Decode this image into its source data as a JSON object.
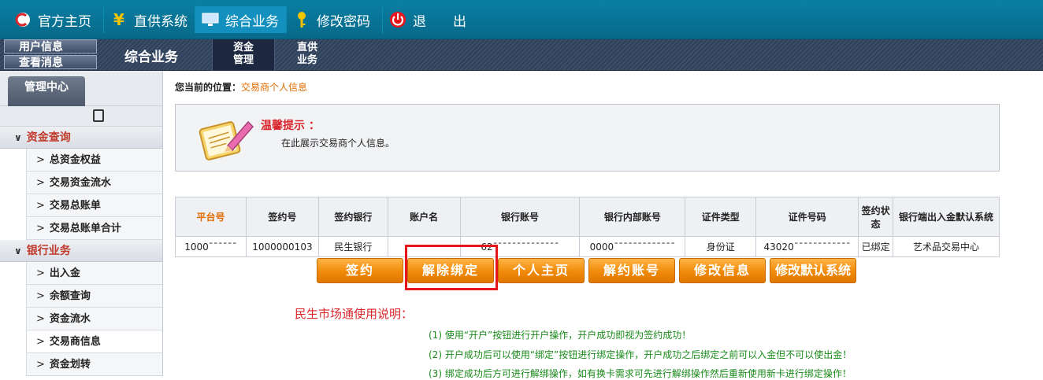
{
  "topnav": {
    "items": [
      {
        "label": "官方主页",
        "icon": "home-logo-icon"
      },
      {
        "label": "直供系统",
        "icon": "yen-icon"
      },
      {
        "label": "综合业务",
        "icon": "monitor-icon"
      },
      {
        "label": "修改密码",
        "icon": "key-icon"
      },
      {
        "label": "退　　出",
        "icon": "power-icon"
      }
    ]
  },
  "subbar": {
    "user_info": "用户信息",
    "view_msg": "查看消息",
    "title": "综合业务",
    "tabs": [
      {
        "line1": "资金",
        "line2": "管理"
      },
      {
        "line1": "直供",
        "line2": "业务"
      }
    ]
  },
  "sidebar": {
    "mgmt_tab": "管理中心",
    "groups": [
      {
        "title": "资金查询",
        "items": [
          "总资金权益",
          "交易资金流水",
          "交易总账单",
          "交易总账单合计"
        ]
      },
      {
        "title": "银行业务",
        "items": [
          "出入金",
          "余额查询",
          "资金流水",
          "交易商信息",
          "资金划转"
        ]
      }
    ],
    "active_item": "交易商信息"
  },
  "breadcrumb": {
    "label": "您当前的位置：",
    "current": "交易商个人信息"
  },
  "tip": {
    "title": "温馨提示 ：",
    "text": "在此展示交易商个人信息。"
  },
  "table": {
    "headers": [
      "平台号",
      "签约号",
      "签约银行",
      "账户名",
      "银行账号",
      "银行内部账号",
      "证件类型",
      "证件号码",
      "签约状态",
      "银行端出入金默认系统"
    ],
    "row": [
      "1000¯¯¯¯¯¯",
      "1000000103",
      "民生银行",
      "",
      "62¯¯¯¯¯¯¯¯¯¯¯¯¯¯",
      "0000¯¯¯¯¯¯¯¯¯¯¯¯¯",
      "身份证",
      "43020¯¯¯¯¯¯¯¯¯¯¯¯",
      "已绑定",
      "艺术品交易中心"
    ]
  },
  "actions": [
    "签约",
    "解除绑定",
    "个人主页",
    "解约账号",
    "修改信息",
    "修改默认系统"
  ],
  "notes": {
    "title": "民生市场通使用说明：",
    "lines": [
      "(1) 使用“开户”按钮进行开户操作，开户成功即视为签约成功！",
      "(2) 开户成功后可以使用“绑定”按钮进行绑定操作，开户成功之后绑定之前可以入金但不可以使出金！",
      "(3) 绑定成功后方可进行解绑操作，如有换卡需求可先进行解绑操作然后重新使用新卡进行绑定操作！"
    ]
  }
}
